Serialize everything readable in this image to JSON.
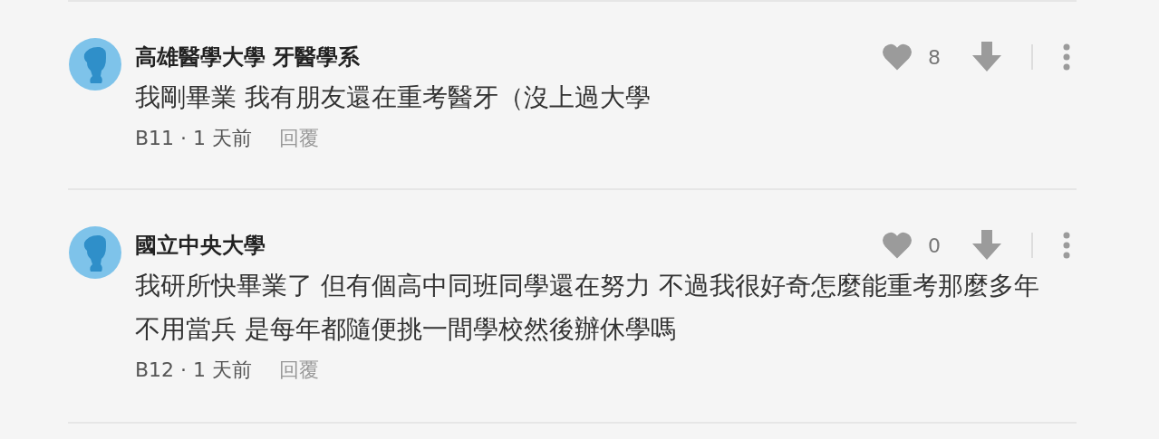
{
  "comments": [
    {
      "author": "高雄醫學大學 牙醫學系",
      "body": "我剛畢業 我有朋友還在重考醫牙（沒上過大學",
      "floor": "B11 · 1 天前",
      "reply": "回覆",
      "likes": "8"
    },
    {
      "author": "國立中央大學",
      "body": "我研所快畢業了 但有個高中同班同學還在努力 不過我很好奇怎麼能重考那麼多年不用當兵 是每年都隨便挑一間學校然後辦休學嗎",
      "floor": "B12 · 1 天前",
      "reply": "回覆",
      "likes": "0"
    }
  ]
}
